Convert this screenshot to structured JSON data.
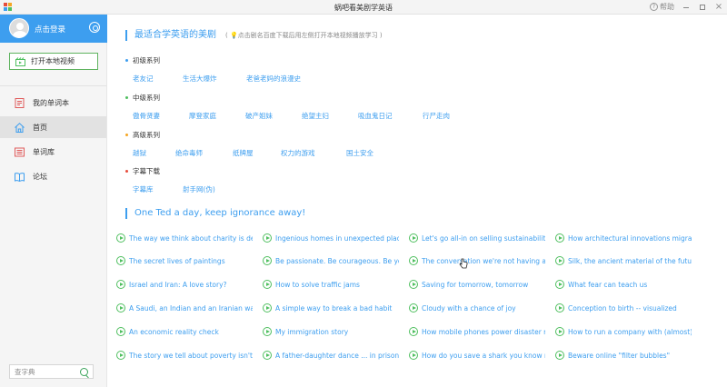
{
  "window": {
    "title": "蜗吧看美剧学英语",
    "help_label": "帮助"
  },
  "sidebar": {
    "login_label": "点击登录",
    "open_local_label": "打开本地视频",
    "nav": [
      {
        "label": "我的单词本",
        "icon": "wordbook-icon",
        "active": false
      },
      {
        "label": "首页",
        "icon": "home-icon",
        "active": true
      },
      {
        "label": "单词库",
        "icon": "wordlist-icon",
        "active": false
      },
      {
        "label": "论坛",
        "icon": "forum-icon",
        "active": false
      }
    ],
    "search_placeholder": "查字典"
  },
  "main": {
    "section1": {
      "title": "最适合学英语的美剧",
      "hint": "( 💡点击剧名百度下载后用左侧打开本地视频播放学习 )"
    },
    "levels": [
      {
        "name": "初级系列",
        "color": "#3d9eef",
        "shows": [
          "老友记",
          "生活大爆炸",
          "老爸老妈的浪漫史"
        ]
      },
      {
        "name": "中级系列",
        "color": "#4fbf5f",
        "shows": [
          "傲骨贤妻",
          "摩登家庭",
          "破产姐妹",
          "绝望主妇",
          "吸血鬼日记",
          "行尸走肉"
        ]
      },
      {
        "name": "高级系列",
        "color": "#f5a623",
        "shows": [
          "越狱",
          "绝命毒师",
          "纸牌屋",
          "权力的游戏",
          "国土安全"
        ]
      },
      {
        "name": "字幕下载",
        "color": "#e74c3c",
        "shows": [
          "字幕库",
          "射手网(伪)"
        ]
      }
    ],
    "section2": {
      "title": "One Ted a day, keep ignorance away!"
    },
    "ted_columns": [
      [
        "The way we think about charity is dead",
        "The secret lives of paintings",
        "Israel and Iran: A love story?",
        "A Saudi, an Indian and an Iranian walk i",
        "An economic reality check",
        "The story we tell about poverty isn't tru"
      ],
      [
        "Ingenious homes in unexpected places",
        "Be passionate. Be courageous. Be your",
        "How to solve traffic jams",
        "A simple way to break a bad habit",
        "My immigration story",
        "A father-daughter dance ... in prison"
      ],
      [
        "Let's go all-in on selling sustainability",
        "The conversation we're not having abou",
        "Saving for tomorrow, tomorrow",
        "Cloudy with a chance of joy",
        "How mobile phones power disaster relie",
        "How do you save a shark you know not"
      ],
      [
        "How architectural innovations migrate",
        "Silk, the ancient material of the future",
        "What fear can teach us",
        "Conception to birth -- visualized",
        "How to run a company with (almost) no",
        "Beware online \"filter bubbles\""
      ]
    ]
  }
}
